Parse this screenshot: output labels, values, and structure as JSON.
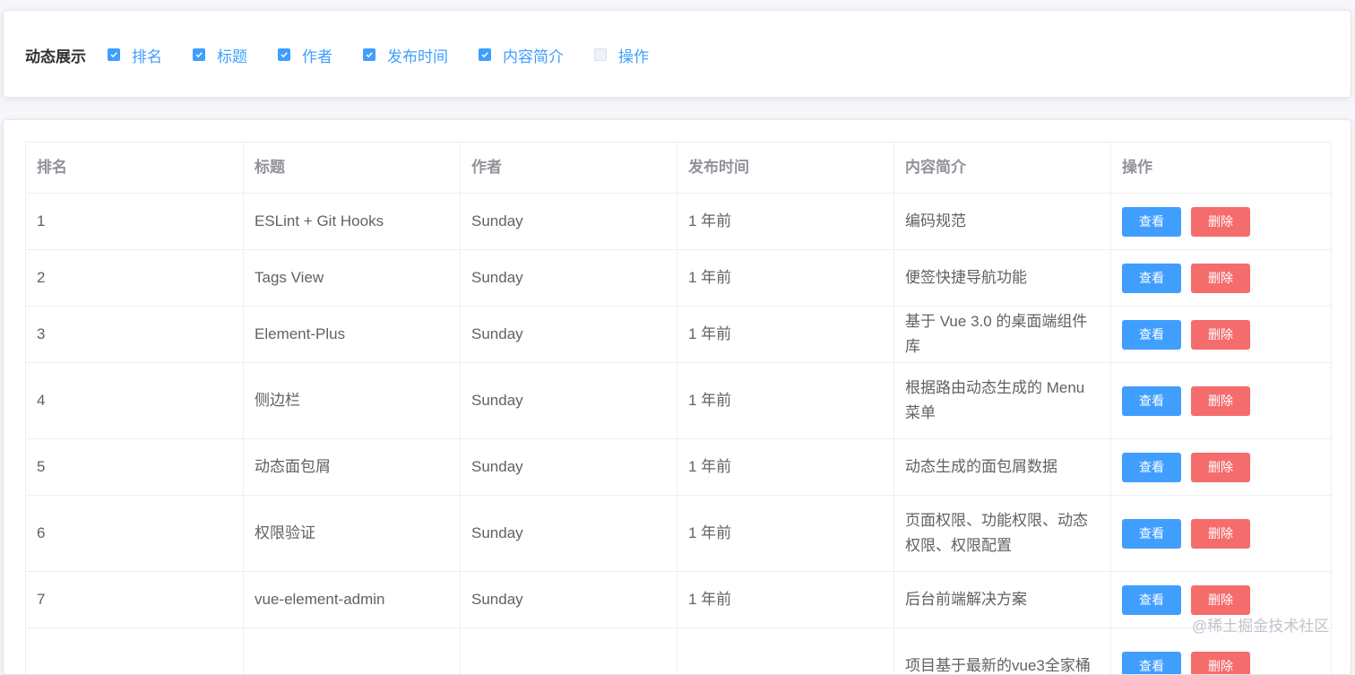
{
  "filter": {
    "title": "动态展示",
    "options": [
      {
        "label": "排名",
        "checked": true
      },
      {
        "label": "标题",
        "checked": true
      },
      {
        "label": "作者",
        "checked": true
      },
      {
        "label": "发布时间",
        "checked": true
      },
      {
        "label": "内容简介",
        "checked": true
      },
      {
        "label": "操作",
        "checked": false
      }
    ]
  },
  "table": {
    "columns": [
      "排名",
      "标题",
      "作者",
      "发布时间",
      "内容简介",
      "操作"
    ],
    "rows": [
      {
        "rank": "1",
        "title": "ESLint + Git Hooks",
        "author": "Sunday",
        "time": "1 年前",
        "desc": "编码规范"
      },
      {
        "rank": "2",
        "title": "Tags View",
        "author": "Sunday",
        "time": "1 年前",
        "desc": "便签快捷导航功能"
      },
      {
        "rank": "3",
        "title": "Element-Plus",
        "author": "Sunday",
        "time": "1 年前",
        "desc": "基于 Vue 3.0 的桌面端组件库"
      },
      {
        "rank": "4",
        "title": "侧边栏",
        "author": "Sunday",
        "time": "1 年前",
        "desc": "根据路由动态生成的 Menu 菜单"
      },
      {
        "rank": "5",
        "title": "动态面包屑",
        "author": "Sunday",
        "time": "1 年前",
        "desc": "动态生成的面包屑数据"
      },
      {
        "rank": "6",
        "title": "权限验证",
        "author": "Sunday",
        "time": "1 年前",
        "desc": "页面权限、功能权限、动态权限、权限配置"
      },
      {
        "rank": "7",
        "title": "vue-element-admin",
        "author": "Sunday",
        "time": "1 年前",
        "desc": "后台前端解决方案"
      },
      {
        "rank": "",
        "title": "",
        "author": "",
        "time": "",
        "desc": "项目基于最新的vue3全家桶"
      }
    ],
    "view_label": "查看",
    "delete_label": "删除"
  },
  "watermark": "@稀土掘金技术社区",
  "colors": {
    "primary": "#409eff",
    "danger": "#f56c6c",
    "header_text": "#909399",
    "body_text": "#606266",
    "border": "#ebeef5"
  }
}
